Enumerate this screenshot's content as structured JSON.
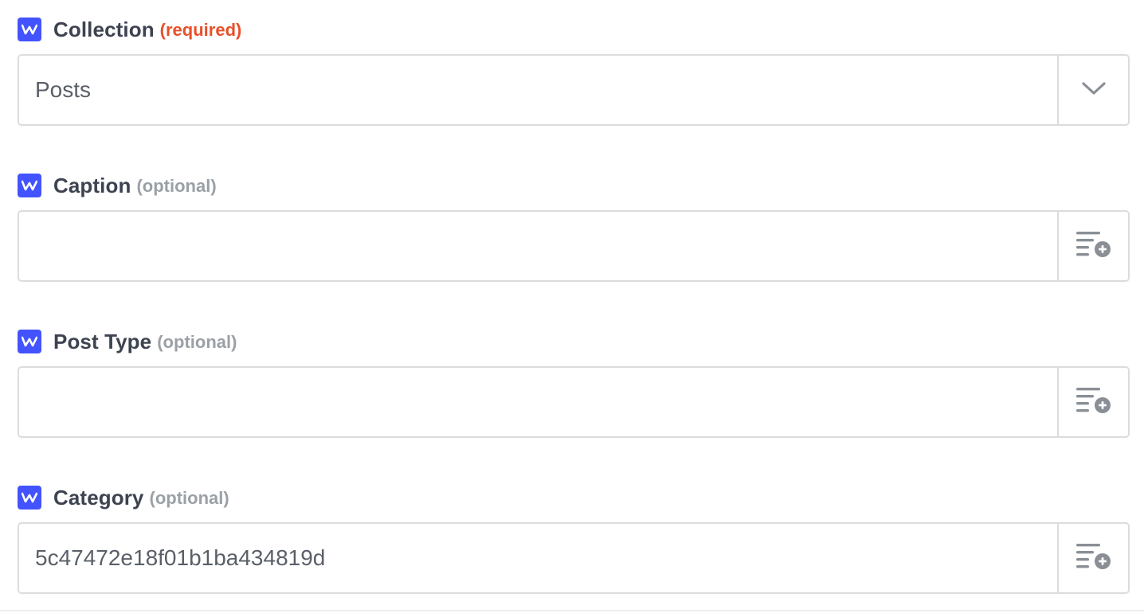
{
  "app": {
    "badge_icon": "webflow-w-icon",
    "badge_color": "#4353ff"
  },
  "colors": {
    "required": "#e8502a",
    "optional": "#9aa0a6",
    "label": "#3d4350",
    "border": "#dcdcdc",
    "value_text": "#5a5f68"
  },
  "fields": [
    {
      "label": "Collection",
      "qualifier": "(required)",
      "qualifier_kind": "required",
      "value": "Posts",
      "control": "dropdown",
      "side_icon": "chevron-down-icon"
    },
    {
      "label": "Caption",
      "qualifier": "(optional)",
      "qualifier_kind": "optional",
      "value": "",
      "control": "text",
      "side_icon": "insert-data-icon"
    },
    {
      "label": "Post Type",
      "qualifier": "(optional)",
      "qualifier_kind": "optional",
      "value": "",
      "control": "text",
      "side_icon": "insert-data-icon"
    },
    {
      "label": "Category",
      "qualifier": "(optional)",
      "qualifier_kind": "optional",
      "value": "5c47472e18f01b1ba434819d",
      "control": "text",
      "side_icon": "insert-data-icon"
    }
  ]
}
